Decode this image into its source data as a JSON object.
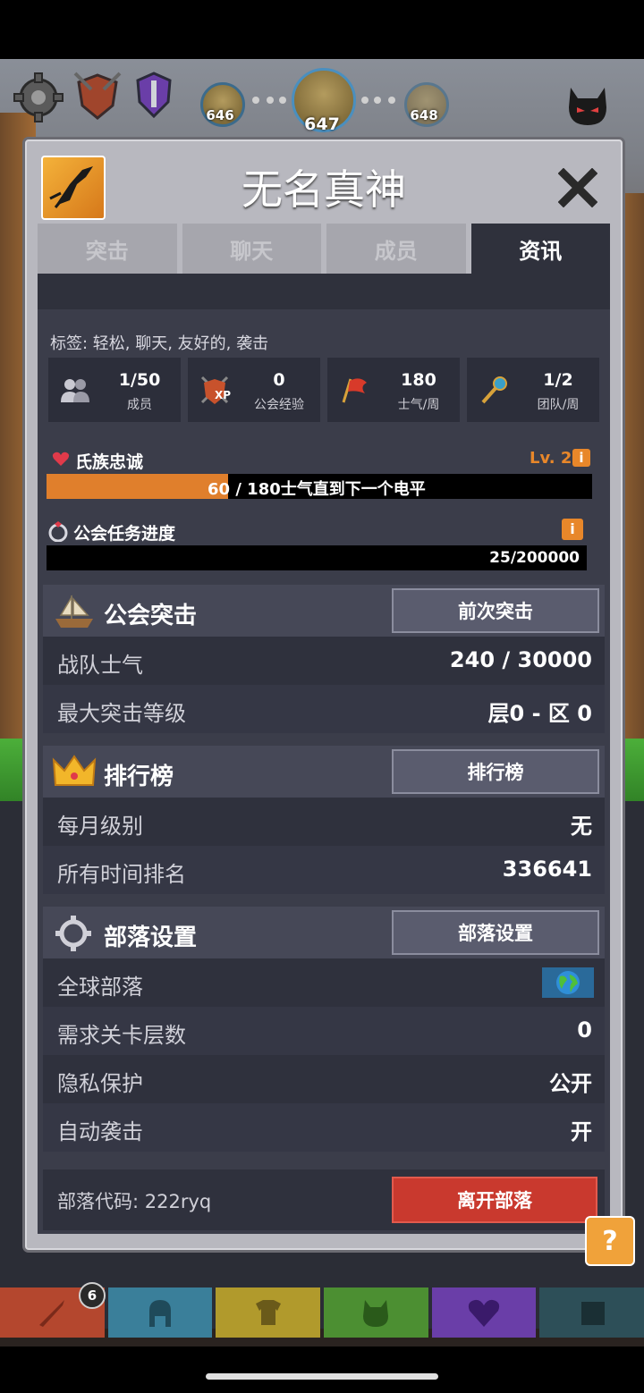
{
  "top": {
    "stages": [
      "646",
      "647",
      "648"
    ]
  },
  "panel": {
    "title": "无名真神",
    "tabs": [
      {
        "label": "突击",
        "active": false
      },
      {
        "label": "聊天",
        "active": false
      },
      {
        "label": "成员",
        "active": false
      },
      {
        "label": "资讯",
        "active": true
      }
    ]
  },
  "info": {
    "tags": "标签: 轻松, 聊天, 友好的, 袭击",
    "stats": [
      {
        "value": "1/50",
        "label": "成员",
        "icon": "members-icon"
      },
      {
        "value": "0",
        "label": "公会经验",
        "icon": "xp-shield-icon"
      },
      {
        "value": "180",
        "label": "士气/周",
        "icon": "flag-icon"
      },
      {
        "value": "1/2",
        "label": "团队/周",
        "icon": "key-icon"
      }
    ],
    "loyalty": {
      "label": "氏族忠诚",
      "level": "Lv. 2",
      "current": "60",
      "rest": " / 180士气直到下一个电平",
      "progress": 0.333
    },
    "quest": {
      "label": "公会任务进度",
      "value": "25/200000",
      "progress": 0.000125
    }
  },
  "raid": {
    "title": "公会突击",
    "button": "前次突击",
    "rows": [
      {
        "key": "战队士气",
        "value": "240 / 30000"
      },
      {
        "key": "最大突击等级",
        "value": "层0 - 区 0"
      }
    ]
  },
  "leaderboard": {
    "title": "排行榜",
    "button": "排行榜",
    "rows": [
      {
        "key": "每月级别",
        "value": "无"
      },
      {
        "key": "所有时间排名",
        "value": "336641"
      }
    ]
  },
  "settings": {
    "title": "部落设置",
    "button": "部落设置",
    "rows": [
      {
        "key": "全球部落",
        "value": ""
      },
      {
        "key": "需求关卡层数",
        "value": "0"
      },
      {
        "key": "隐私保护",
        "value": "公开"
      },
      {
        "key": "自动袭击",
        "value": "开"
      }
    ]
  },
  "footer": {
    "code": "部落代码: 222ryq",
    "leave": "离开部落"
  },
  "help": "?",
  "nav": {
    "badge": "6",
    "colors": [
      "#b4472e",
      "#3a7f9a",
      "#b19a2c",
      "#4c8f32",
      "#6a3ea8",
      "#2d4f58"
    ]
  }
}
